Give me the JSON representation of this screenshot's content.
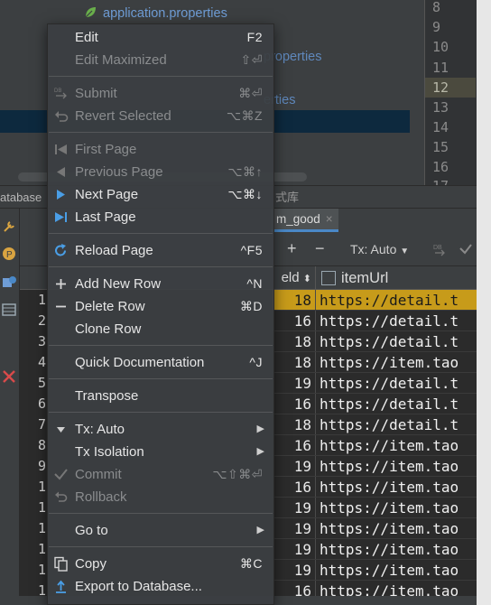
{
  "project": {
    "file_items": [
      "application.properties",
      "properties",
      "erties"
    ]
  },
  "editor": {
    "line_numbers": [
      "8",
      "9",
      "10",
      "11",
      "12",
      "13",
      "14",
      "15",
      "16",
      "17"
    ],
    "active_line": "12"
  },
  "database_panel": {
    "title": "atabase",
    "cn_text": "式库",
    "tab_label": "m_good",
    "tab_close": "×",
    "toolbar": {
      "add": "+",
      "remove": "−",
      "tx_label": "Tx: Auto"
    }
  },
  "grid": {
    "columns": [
      "eld",
      "itemUrl"
    ],
    "sort_glyph": "⬍",
    "row_numbers": [
      "1",
      "2",
      "3",
      "4",
      "5",
      "6",
      "7",
      "8",
      "9",
      "1",
      "1",
      "1",
      "1",
      "1",
      "1"
    ],
    "rows": [
      {
        "id": "18",
        "url": "https://detail.t"
      },
      {
        "id": "16",
        "url": "https://detail.t"
      },
      {
        "id": "18",
        "url": "https://detail.t"
      },
      {
        "id": "18",
        "url": "https://item.tao"
      },
      {
        "id": "19",
        "url": "https://detail.t"
      },
      {
        "id": "16",
        "url": "https://detail.t"
      },
      {
        "id": "18",
        "url": "https://detail.t"
      },
      {
        "id": "16",
        "url": "https://item.tao"
      },
      {
        "id": "19",
        "url": "https://item.tao"
      },
      {
        "id": "16",
        "url": "https://item.tao"
      },
      {
        "id": "19",
        "url": "https://item.tao"
      },
      {
        "id": "19",
        "url": "https://item.tao"
      },
      {
        "id": "19",
        "url": "https://item.tao"
      },
      {
        "id": "19",
        "url": "https://item.tao"
      },
      {
        "id": "16",
        "url": "https://item.tao"
      }
    ],
    "selected_row": 0
  },
  "context_menu": {
    "items": [
      {
        "label": "Edit",
        "shortcut": "F2",
        "enabled": true,
        "icon": ""
      },
      {
        "label": "Edit Maximized",
        "shortcut": "⇧⏎",
        "enabled": false,
        "icon": ""
      },
      {
        "label": "Submit",
        "shortcut": "⌘⏎",
        "enabled": false,
        "icon": "db-submit-icon"
      },
      {
        "label": "Revert Selected",
        "shortcut": "⌥⌘Z",
        "enabled": false,
        "icon": "revert-icon"
      },
      {
        "label": "First Page",
        "shortcut": "",
        "enabled": false,
        "icon": "first-page-icon"
      },
      {
        "label": "Previous Page",
        "shortcut": "⌥⌘↑",
        "enabled": false,
        "icon": "previous-page-icon"
      },
      {
        "label": "Next Page",
        "shortcut": "⌥⌘↓",
        "enabled": true,
        "icon": "next-page-icon"
      },
      {
        "label": "Last Page",
        "shortcut": "",
        "enabled": true,
        "icon": "last-page-icon"
      },
      {
        "label": "Reload Page",
        "shortcut": "^F5",
        "enabled": true,
        "icon": "reload-icon"
      },
      {
        "label": "Add New Row",
        "shortcut": "^N",
        "enabled": true,
        "icon": "plus-icon"
      },
      {
        "label": "Delete Row",
        "shortcut": "⌘D",
        "enabled": true,
        "icon": "minus-icon"
      },
      {
        "label": "Clone Row",
        "shortcut": "",
        "enabled": true,
        "icon": ""
      },
      {
        "label": "Quick Documentation",
        "shortcut": "^J",
        "enabled": true,
        "icon": ""
      },
      {
        "label": "Transpose",
        "shortcut": "",
        "enabled": true,
        "icon": ""
      },
      {
        "label": "Tx: Auto",
        "shortcut": "",
        "enabled": true,
        "icon": "dropdown-triangle-icon",
        "submenu": true
      },
      {
        "label": "Tx Isolation",
        "shortcut": "",
        "enabled": true,
        "icon": "",
        "submenu": true
      },
      {
        "label": "Commit",
        "shortcut": "⌥⇧⌘⏎",
        "enabled": false,
        "icon": "check-icon"
      },
      {
        "label": "Rollback",
        "shortcut": "",
        "enabled": false,
        "icon": "rollback-icon"
      },
      {
        "label": "Go to",
        "shortcut": "",
        "enabled": true,
        "icon": "",
        "submenu": true
      },
      {
        "label": "Copy",
        "shortcut": "⌘C",
        "enabled": true,
        "icon": "copy-icon"
      },
      {
        "label": "Export to Database...",
        "shortcut": "",
        "enabled": true,
        "icon": "export-icon"
      }
    ],
    "submenu_arrow": "▶",
    "colors": {
      "background": "#3c3f41",
      "text": "#e6e6e6",
      "disabled_text": "#8a8c8e"
    }
  },
  "colors": {
    "selected_row": "#c79b1a",
    "link_blue": "#6f9dd6",
    "accent": "#4a88c7"
  }
}
